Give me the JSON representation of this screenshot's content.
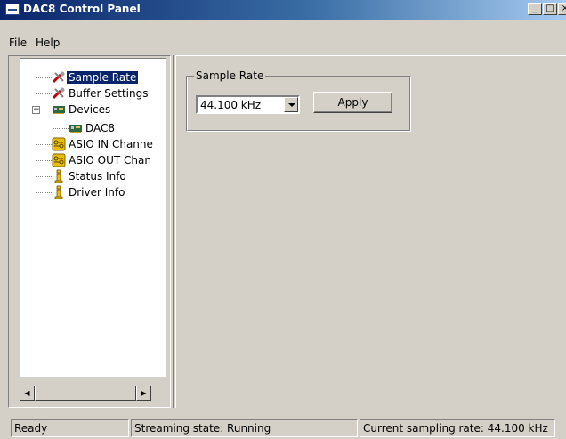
{
  "window": {
    "title": "DAC8 Control Panel",
    "minimize": "_",
    "restore": "□",
    "close": "×"
  },
  "menu": [
    "File",
    "Help"
  ],
  "tree": {
    "items": [
      {
        "label": "Sample Rate",
        "icon": "tools-icon",
        "selected": true
      },
      {
        "label": "Buffer Settings",
        "icon": "tools-icon"
      },
      {
        "label": "Devices",
        "icon": "device-card-icon",
        "expander": "−"
      },
      {
        "label": "DAC8",
        "icon": "device-card-icon"
      },
      {
        "label": "ASIO IN Channe",
        "icon": "channel-icon"
      },
      {
        "label": "ASIO OUT Chan",
        "icon": "channel-icon"
      },
      {
        "label": "Status Info",
        "icon": "info-icon"
      },
      {
        "label": "Driver Info",
        "icon": "info-icon"
      }
    ]
  },
  "scrollbar": {
    "left_arrow": "◀",
    "right_arrow": "▶"
  },
  "sample_rate_group": {
    "label": "Sample Rate",
    "selected_value": "44.100 kHz",
    "apply_label": "Apply"
  },
  "status": {
    "ready": "Ready",
    "streaming": "Streaming state: Running",
    "sampling": "Current sampling rate: 44.100 kHz"
  },
  "colors": {
    "face": "#d4d0c8",
    "selection": "#0a246a",
    "title_start": "#0a246a",
    "title_end": "#a6caf0"
  }
}
